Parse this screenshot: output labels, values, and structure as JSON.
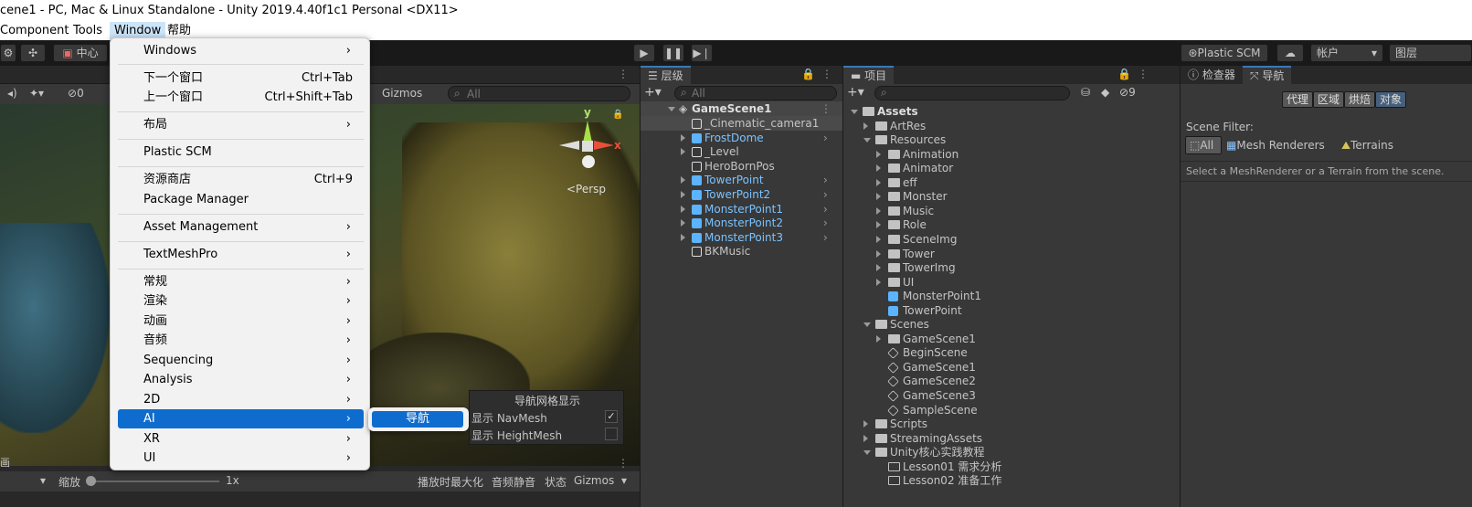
{
  "window": {
    "title": "cene1 - PC, Mac & Linux Standalone - Unity 2019.4.40f1c1 Personal <DX11>"
  },
  "menubar": {
    "items": [
      "Component",
      "Tools",
      "Window",
      "帮助"
    ],
    "selected": "Window"
  },
  "toolbar": {
    "pivot_label": "中心",
    "plastic_label": "Plastic SCM",
    "account_label": "帐户",
    "layers_label": "图层"
  },
  "scene": {
    "gizmos_label": "Gizmos",
    "search_placeholder": "All",
    "counter": "0",
    "persp_label": "<Persp",
    "axis_y": "y",
    "axis_x": "x",
    "mode_tabs_first": "画"
  },
  "game": {
    "zoom_label": "缩放",
    "zoom_value": "1x",
    "maximize_label": "播放时最大化",
    "mute_label": "音频静音",
    "stats_label": "状态",
    "gizmos_label": "Gizmos"
  },
  "window_menu": {
    "items": [
      {
        "label": "Windows",
        "shortcut": "",
        "submenu": true
      },
      {
        "label": "下一个窗口",
        "shortcut": "Ctrl+Tab",
        "submenu": false
      },
      {
        "label": "上一个窗口",
        "shortcut": "Ctrl+Shift+Tab",
        "submenu": false
      },
      {
        "label": "布局",
        "shortcut": "",
        "submenu": true
      },
      {
        "label": "Plastic SCM",
        "shortcut": "",
        "submenu": false
      },
      {
        "label": "资源商店",
        "shortcut": "Ctrl+9",
        "submenu": false
      },
      {
        "label": "Package Manager",
        "shortcut": "",
        "submenu": false
      },
      {
        "label": "Asset Management",
        "shortcut": "",
        "submenu": true
      },
      {
        "label": "TextMeshPro",
        "shortcut": "",
        "submenu": true
      },
      {
        "label": "常规",
        "shortcut": "",
        "submenu": true
      },
      {
        "label": "渲染",
        "shortcut": "",
        "submenu": true
      },
      {
        "label": "动画",
        "shortcut": "",
        "submenu": true
      },
      {
        "label": "音频",
        "shortcut": "",
        "submenu": true
      },
      {
        "label": "Sequencing",
        "shortcut": "",
        "submenu": true
      },
      {
        "label": "Analysis",
        "shortcut": "",
        "submenu": true
      },
      {
        "label": "2D",
        "shortcut": "",
        "submenu": true
      },
      {
        "label": "AI",
        "shortcut": "",
        "submenu": true
      },
      {
        "label": "XR",
        "shortcut": "",
        "submenu": true
      },
      {
        "label": "UI",
        "shortcut": "",
        "submenu": true
      }
    ],
    "highlighted": "AI",
    "submenu_ai": [
      "导航"
    ]
  },
  "nav_overlay": {
    "title": "导航网格显示",
    "options": [
      {
        "label": "显示 NavMesh",
        "checked": true
      },
      {
        "label": "显示 HeightMesh",
        "checked": false
      }
    ]
  },
  "hierarchy": {
    "tab_label": "层级",
    "search_placeholder": "All",
    "root": "GameScene1",
    "items": [
      {
        "label": "_Cinematic_camera1",
        "prefab": false,
        "expandable": false
      },
      {
        "label": "FrostDome",
        "prefab": true,
        "expandable": true
      },
      {
        "label": "_Level",
        "prefab": false,
        "expandable": true
      },
      {
        "label": "HeroBornPos",
        "prefab": false,
        "expandable": false
      },
      {
        "label": "TowerPoint",
        "prefab": true,
        "expandable": true
      },
      {
        "label": "TowerPoint2",
        "prefab": true,
        "expandable": true
      },
      {
        "label": "MonsterPoint1",
        "prefab": true,
        "expandable": true
      },
      {
        "label": "MonsterPoint2",
        "prefab": true,
        "expandable": true
      },
      {
        "label": "MonsterPoint3",
        "prefab": true,
        "expandable": true
      },
      {
        "label": "BKMusic",
        "prefab": false,
        "expandable": false
      }
    ]
  },
  "project": {
    "tab_label": "项目",
    "hidden_count": "9",
    "tree": [
      {
        "label": "Assets",
        "depth": 0,
        "kind": "folder-open",
        "bold": true
      },
      {
        "label": "ArtRes",
        "depth": 1,
        "kind": "folder"
      },
      {
        "label": "Resources",
        "depth": 1,
        "kind": "folder-open"
      },
      {
        "label": "Animation",
        "depth": 2,
        "kind": "folder"
      },
      {
        "label": "Animator",
        "depth": 2,
        "kind": "folder"
      },
      {
        "label": "eff",
        "depth": 2,
        "kind": "folder"
      },
      {
        "label": "Monster",
        "depth": 2,
        "kind": "folder"
      },
      {
        "label": "Music",
        "depth": 2,
        "kind": "folder"
      },
      {
        "label": "Role",
        "depth": 2,
        "kind": "folder"
      },
      {
        "label": "SceneImg",
        "depth": 2,
        "kind": "folder"
      },
      {
        "label": "Tower",
        "depth": 2,
        "kind": "folder"
      },
      {
        "label": "TowerImg",
        "depth": 2,
        "kind": "folder"
      },
      {
        "label": "UI",
        "depth": 2,
        "kind": "folder"
      },
      {
        "label": "MonsterPoint1",
        "depth": 2,
        "kind": "prefab"
      },
      {
        "label": "TowerPoint",
        "depth": 2,
        "kind": "prefab"
      },
      {
        "label": "Scenes",
        "depth": 1,
        "kind": "folder-open"
      },
      {
        "label": "GameScene1",
        "depth": 2,
        "kind": "folder"
      },
      {
        "label": "BeginScene",
        "depth": 2,
        "kind": "scene"
      },
      {
        "label": "GameScene1",
        "depth": 2,
        "kind": "scene"
      },
      {
        "label": "GameScene2",
        "depth": 2,
        "kind": "scene"
      },
      {
        "label": "GameScene3",
        "depth": 2,
        "kind": "scene"
      },
      {
        "label": "SampleScene",
        "depth": 2,
        "kind": "scene"
      },
      {
        "label": "Scripts",
        "depth": 1,
        "kind": "folder"
      },
      {
        "label": "StreamingAssets",
        "depth": 1,
        "kind": "folder"
      },
      {
        "label": "Unity核心实践教程",
        "depth": 1,
        "kind": "folder-open"
      },
      {
        "label": "Lesson01 需求分析",
        "depth": 2,
        "kind": "empty-folder"
      },
      {
        "label": "Lesson02 准备工作",
        "depth": 2,
        "kind": "empty-folder"
      }
    ]
  },
  "inspector": {
    "tabs": [
      "检查器",
      "导航"
    ],
    "active_tab": "导航",
    "modes": [
      "代理",
      "区域",
      "烘焙",
      "对象"
    ],
    "active_mode": "对象",
    "scene_filter_label": "Scene Filter:",
    "filters": [
      "All",
      "Mesh Renderers",
      "Terrains"
    ],
    "hint": "Select a MeshRenderer or a Terrain from the scene."
  },
  "colors": {
    "accent": "#0f6ccf",
    "prefab_blue": "#7bc2ff",
    "panel_bg": "#383838"
  }
}
